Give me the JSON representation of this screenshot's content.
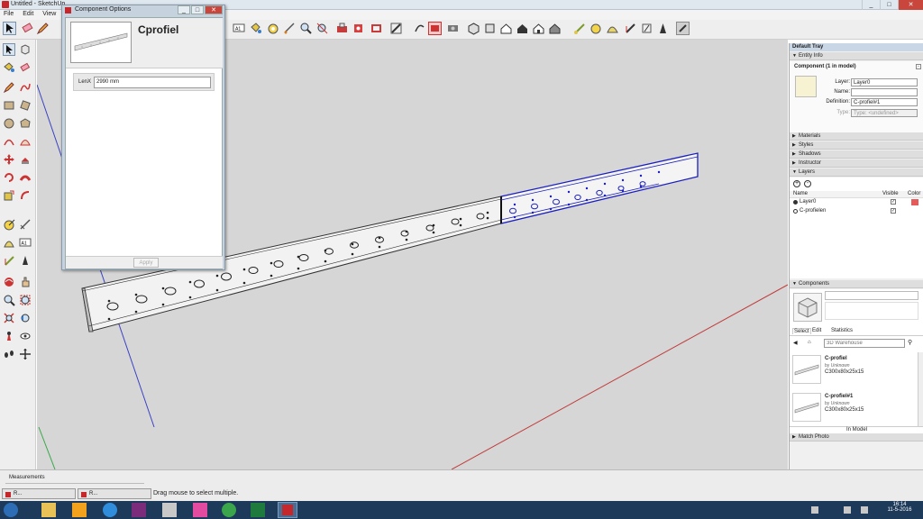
{
  "window": {
    "title": "Untitled - SketchUp",
    "controls": [
      "_",
      "□",
      "✕"
    ]
  },
  "menu": [
    "File",
    "Edit",
    "View",
    "Ca"
  ],
  "dialog": {
    "title": "Component Options",
    "component_name": "Cprofiel",
    "attribute_label": "LenX",
    "attribute_value": "2990 mm",
    "apply_label": "Apply"
  },
  "tray": {
    "title": "Default Tray",
    "entity_info": {
      "header": "Entity Info",
      "summary": "Component (1 in model)",
      "layer_label": "Layer:",
      "layer_value": "Layer0",
      "name_label": "Name:",
      "name_value": "",
      "definition_label": "Definition:",
      "definition_value": "C-profiel#1",
      "type_label": "Type:",
      "type_value": "Type: <undefined>"
    },
    "sections": [
      "Materials",
      "Styles",
      "Shadows",
      "Instructor"
    ],
    "layers": {
      "header": "Layers",
      "col_name": "Name",
      "col_visible": "Visible",
      "col_color": "Color",
      "rows": [
        {
          "name": "Layer0",
          "active": true,
          "color": "#e85a5a"
        },
        {
          "name": "C-profielen",
          "active": false,
          "color": ""
        }
      ]
    },
    "components": {
      "header": "Components",
      "tabs": [
        "Select",
        "Edit",
        "Statistics"
      ],
      "search_placeholder": "3D Warehouse",
      "items": [
        {
          "name": "C-profiel",
          "by": "by",
          "author": "Unknown",
          "desc": "C300x80x25x15"
        },
        {
          "name": "C-profiel#1",
          "by": "by",
          "author": "Unknown",
          "desc": "C300x80x25x15"
        }
      ],
      "footer": "In Model"
    },
    "match_photo": "Match Photo"
  },
  "status": {
    "measurements_label": "Measurements",
    "hint": "Drag mouse to select multiple.",
    "tasks": [
      "R...",
      "R..."
    ]
  },
  "clock": {
    "time": "16:14",
    "date": "11-5-2016"
  }
}
